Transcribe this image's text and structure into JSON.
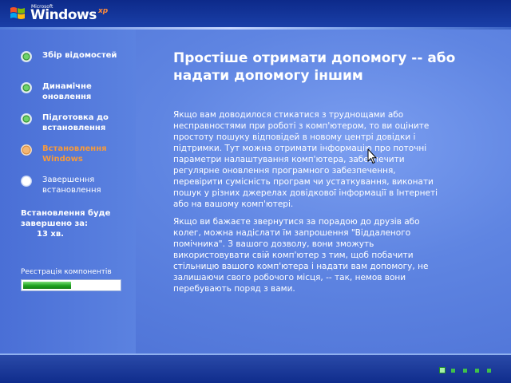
{
  "brand": {
    "company": "Microsoft",
    "product": "Windows",
    "edition": "xp",
    "colors": {
      "top_bar": "#0d2a8a",
      "content": "#5f85e2",
      "done_step": "#1f7d22",
      "current_step": "#f59a3d",
      "progress": "#1fa21f"
    }
  },
  "steps": [
    {
      "label": "Збір відомостей",
      "state": "done",
      "icon": "check-dot-icon"
    },
    {
      "label": "Динамічне оновлення",
      "state": "done",
      "icon": "check-dot-icon"
    },
    {
      "label": "Підготовка до встановлення",
      "state": "done",
      "icon": "check-dot-icon"
    },
    {
      "label": "Встановлення Windows",
      "state": "current",
      "icon": "current-dot-icon"
    },
    {
      "label": "Завершення встановлення",
      "state": "pending",
      "icon": "pending-dot-icon"
    }
  ],
  "eta": {
    "label": "Встановлення буде завершено за:",
    "time": "13 хв."
  },
  "progress": {
    "label": "Реєстрація компонентів",
    "fraction": 0.5
  },
  "content": {
    "headline": "Простіше отримати допомогу -- або надати допомогу іншим",
    "paragraphs": [
      "Якщо вам доводилося стикатися з труднощами або несправностями при роботі з комп'ютером, то ви оціните простоту пошуку відповідей в новому центрі довідки і підтримки. Тут можна отримати інформацію про поточні параметри налаштування комп'ютера, забезпечити регулярне оновлення програмного забезпечення, перевірити сумісність програм чи устаткування, виконати пошук у різних джерелах довідкової інформації в Інтернеті або на вашому комп'ютері.",
      "Якщо ви бажаєте звернутися за порадою до друзів або колег, можна надіслати їм запрошення \"Віддаленого помічника\". З вашого дозволу, вони зможуть використовувати свій комп'ютер з тим, щоб побачити стільницю вашого комп'ютера і надати вам допомогу, не залишаючи свого робочого місця, -- так, немов вони перебувають поряд з вами."
    ]
  },
  "slideshow": {
    "total": 5,
    "current": 1
  }
}
